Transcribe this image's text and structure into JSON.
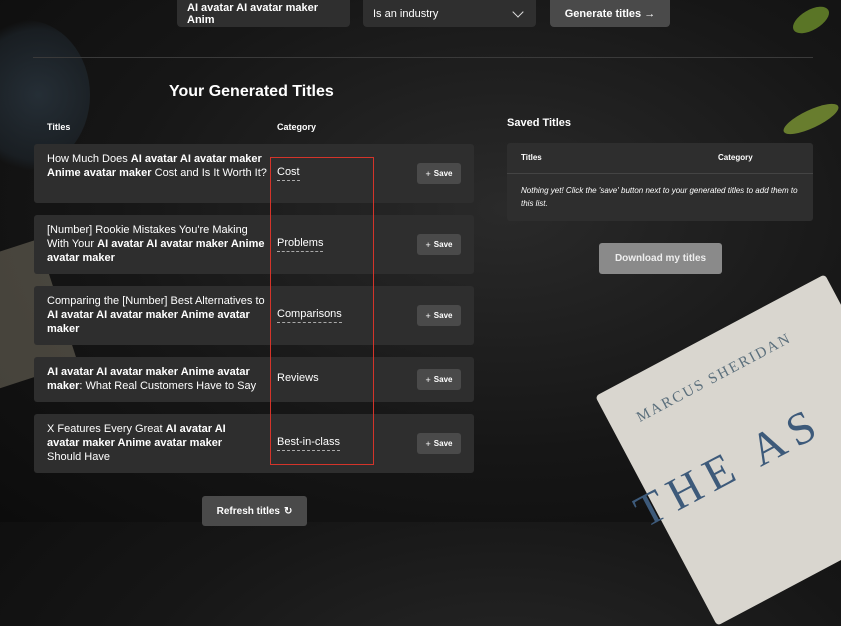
{
  "topbar": {
    "keyword_value": "AI avatar AI avatar maker Anim",
    "industry_select": "Is an industry",
    "generate_label": "Generate titles →"
  },
  "generated": {
    "heading": "Your Generated Titles",
    "col_titles": "Titles",
    "col_category": "Category",
    "save_label": "Save",
    "rows": [
      {
        "pre": "How Much Does ",
        "bold": "AI avatar AI avatar maker Anime avatar maker",
        "post": " Cost and Is It Worth It?",
        "category": "Cost"
      },
      {
        "pre": "[Number] Rookie Mistakes You're Making With Your ",
        "bold": "AI avatar AI avatar maker Anime avatar maker",
        "post": "",
        "category": "Problems"
      },
      {
        "pre": "Comparing the [Number] Best Alternatives to ",
        "bold": "AI avatar AI avatar maker Anime avatar maker",
        "post": "",
        "category": "Comparisons"
      },
      {
        "pre": "",
        "bold": "AI avatar AI avatar maker Anime avatar maker",
        "post": ": What Real Customers Have to Say",
        "category": "Reviews"
      },
      {
        "pre": "X Features Every Great ",
        "bold": "AI avatar AI avatar maker Anime avatar maker",
        "post": " Should Have",
        "category": "Best-in-class"
      }
    ],
    "refresh_label": "Refresh titles"
  },
  "saved": {
    "heading": "Saved Titles",
    "col_titles": "Titles",
    "col_category": "Category",
    "empty_text": "Nothing yet! Click the 'save' button next to your generated titles to add them to this list.",
    "download_label": "Download my titles"
  },
  "background": {
    "book_author": "MARCUS SHERIDAN",
    "book_title": "THE AS"
  },
  "colors": {
    "highlight_border": "#d4342a",
    "button_bg": "#4a4a4a",
    "row_bg": "#2e2e2e"
  }
}
